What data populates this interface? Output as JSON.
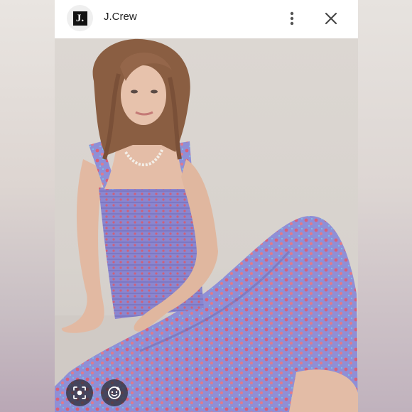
{
  "header": {
    "logo_letter": "J.",
    "brand_name": "J.Crew"
  },
  "icons": {
    "more": "more-vertical-icon",
    "close": "close-icon",
    "lens": "visual-search-icon",
    "face": "face-sticker-icon"
  },
  "colors": {
    "dress_base": "#8f8fd6",
    "dress_print": "#d8607a",
    "skin": "#e2b9a2",
    "hair": "#8a5e42",
    "backdrop": "#dcd7d2"
  }
}
